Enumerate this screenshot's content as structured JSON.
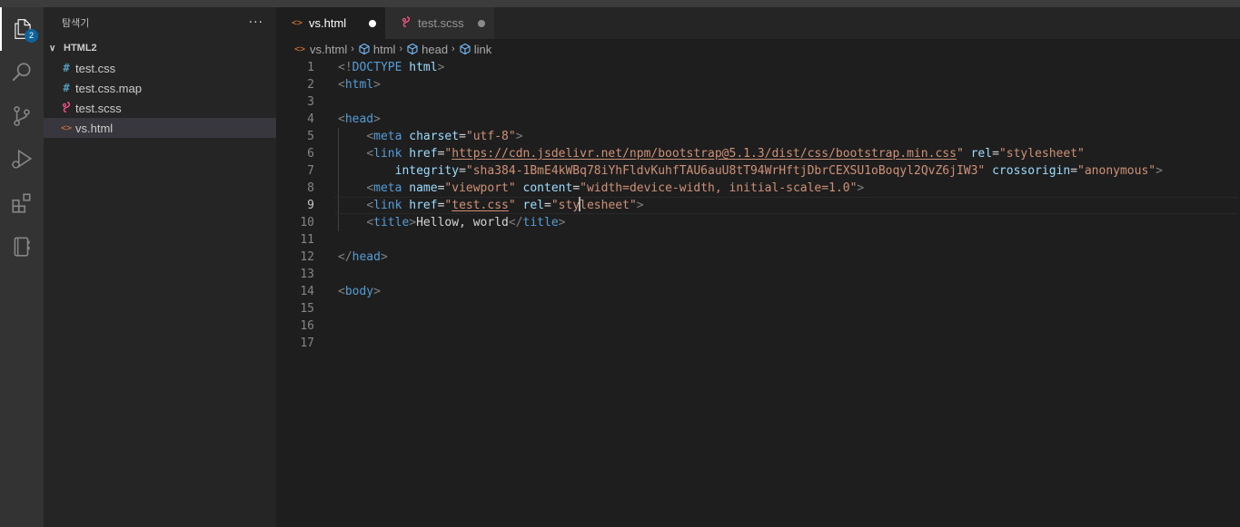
{
  "activity_bar": {
    "explorer_badge": "2",
    "items": [
      "files-icon",
      "search-icon",
      "source-control-icon",
      "run-debug-icon",
      "extensions-icon",
      "notebook-icon"
    ]
  },
  "sidebar": {
    "title": "탐색기",
    "more": "···",
    "folder": "HTML2",
    "files": [
      {
        "name": "test.css",
        "icon": "css-icon"
      },
      {
        "name": "test.css.map",
        "icon": "css-icon"
      },
      {
        "name": "test.scss",
        "icon": "scss-icon"
      },
      {
        "name": "vs.html",
        "icon": "html-icon",
        "selected": true
      }
    ]
  },
  "tabs": [
    {
      "label": "vs.html",
      "active": true
    },
    {
      "label": "test.scss",
      "active": false
    }
  ],
  "breadcrumb": [
    "vs.html",
    "html",
    "head",
    "link"
  ],
  "editor": {
    "current_line": 9,
    "line_numbers": [
      "1",
      "2",
      "3",
      "4",
      "5",
      "6",
      "7",
      "8",
      "9",
      "10",
      "11",
      "12",
      "13",
      "14",
      "15",
      "16",
      "17"
    ],
    "lines": [
      {
        "indent": "",
        "tokens": [
          [
            "br",
            "<!"
          ],
          [
            "tag",
            "DOCTYPE"
          ],
          [
            "txt",
            " "
          ],
          [
            "attr",
            "html"
          ],
          [
            "br",
            ">"
          ]
        ]
      },
      {
        "indent": "",
        "tokens": [
          [
            "br",
            "<"
          ],
          [
            "tag",
            "html"
          ],
          [
            "br",
            ">"
          ]
        ]
      },
      {
        "indent": "",
        "tokens": []
      },
      {
        "indent": "",
        "tokens": [
          [
            "br",
            "<"
          ],
          [
            "tag",
            "head"
          ],
          [
            "br",
            ">"
          ]
        ]
      },
      {
        "indent": "    ",
        "tokens": [
          [
            "br",
            "<"
          ],
          [
            "tag",
            "meta"
          ],
          [
            "txt",
            " "
          ],
          [
            "attr",
            "charset"
          ],
          [
            "txt",
            "="
          ],
          [
            "str",
            "\"utf-8\""
          ],
          [
            "br",
            ">"
          ]
        ]
      },
      {
        "indent": "    ",
        "tokens": [
          [
            "br",
            "<"
          ],
          [
            "tag",
            "link"
          ],
          [
            "txt",
            " "
          ],
          [
            "attr",
            "href"
          ],
          [
            "txt",
            "="
          ],
          [
            "str",
            "\""
          ],
          [
            "stru",
            "https://cdn.jsdelivr.net/npm/bootstrap@5.1.3/dist/css/bootstrap.min.css"
          ],
          [
            "str",
            "\""
          ],
          [
            "txt",
            " "
          ],
          [
            "attr",
            "rel"
          ],
          [
            "txt",
            "="
          ],
          [
            "str",
            "\"stylesheet\""
          ]
        ]
      },
      {
        "indent": "        ",
        "tokens": [
          [
            "attr",
            "integrity"
          ],
          [
            "txt",
            "="
          ],
          [
            "str",
            "\"sha384-1BmE4kWBq78iYhFldvKuhfTAU6auU8tT94WrHftjDbrCEXSU1oBoqyl2QvZ6jIW3\""
          ],
          [
            "txt",
            " "
          ],
          [
            "attr",
            "crossorigin"
          ],
          [
            "txt",
            "="
          ],
          [
            "str",
            "\"anonymous\""
          ],
          [
            "br",
            ">"
          ]
        ]
      },
      {
        "indent": "    ",
        "tokens": [
          [
            "br",
            "<"
          ],
          [
            "tag",
            "meta"
          ],
          [
            "txt",
            " "
          ],
          [
            "attr",
            "name"
          ],
          [
            "txt",
            "="
          ],
          [
            "str",
            "\"viewport\""
          ],
          [
            "txt",
            " "
          ],
          [
            "attr",
            "content"
          ],
          [
            "txt",
            "="
          ],
          [
            "str",
            "\"width=device-width, initial-scale=1.0\""
          ],
          [
            "br",
            ">"
          ]
        ]
      },
      {
        "indent": "    ",
        "tokens": [
          [
            "br",
            "<"
          ],
          [
            "tag",
            "link"
          ],
          [
            "txt",
            " "
          ],
          [
            "attr",
            "href"
          ],
          [
            "txt",
            "="
          ],
          [
            "str",
            "\""
          ],
          [
            "stru",
            "test.css"
          ],
          [
            "str",
            "\""
          ],
          [
            "txt",
            " "
          ],
          [
            "attr",
            "rel"
          ],
          [
            "txt",
            "="
          ],
          [
            "str",
            "\"sty"
          ],
          [
            "cursor",
            ""
          ],
          [
            "str",
            "lesheet\""
          ],
          [
            "br",
            ">"
          ]
        ]
      },
      {
        "indent": "    ",
        "tokens": [
          [
            "br",
            "<"
          ],
          [
            "tag",
            "title"
          ],
          [
            "br",
            ">"
          ],
          [
            "txt",
            "Hellow, world"
          ],
          [
            "br",
            "</"
          ],
          [
            "tag",
            "title"
          ],
          [
            "br",
            ">"
          ]
        ]
      },
      {
        "indent": "",
        "tokens": []
      },
      {
        "indent": "",
        "tokens": [
          [
            "br",
            "</"
          ],
          [
            "tag",
            "head"
          ],
          [
            "br",
            ">"
          ]
        ]
      },
      {
        "indent": "",
        "tokens": []
      },
      {
        "indent": "",
        "tokens": [
          [
            "br",
            "<"
          ],
          [
            "tag",
            "body"
          ],
          [
            "br",
            ">"
          ]
        ]
      },
      {
        "indent": "",
        "tokens": []
      },
      {
        "indent": "",
        "tokens": []
      },
      {
        "indent": "",
        "tokens": []
      }
    ]
  }
}
